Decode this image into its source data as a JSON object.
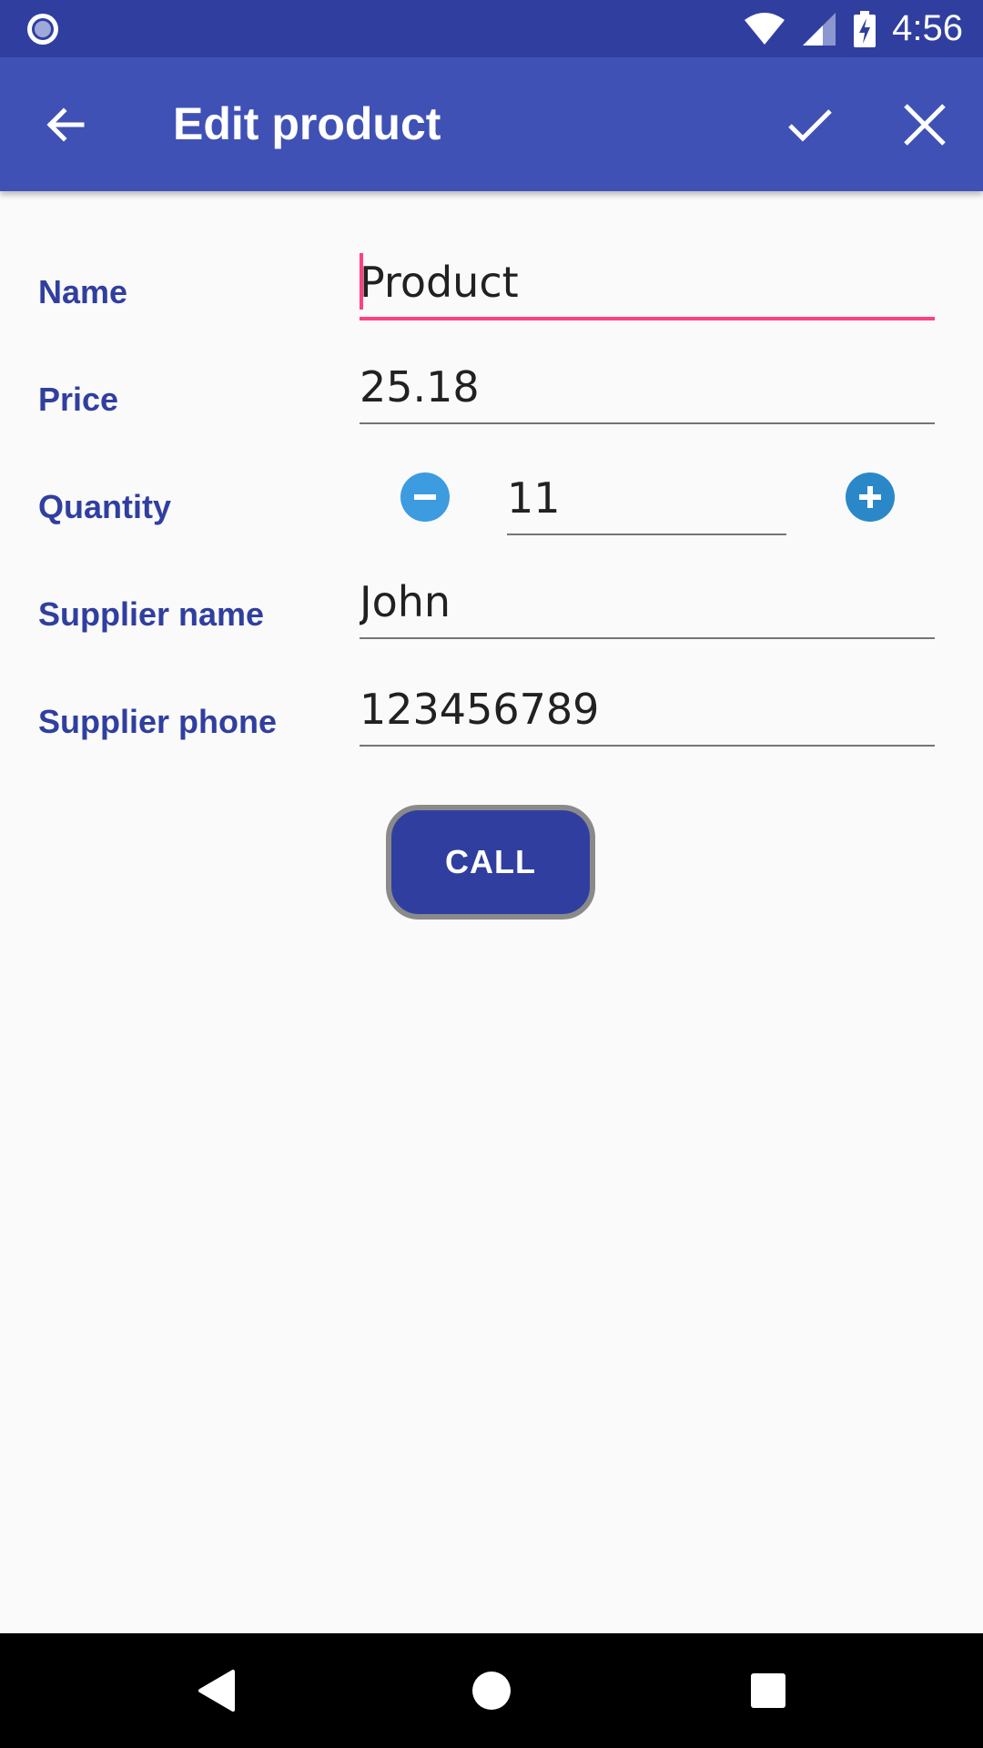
{
  "status_bar": {
    "time": "4:56",
    "icons": [
      "notification-dot-icon",
      "wifi-icon",
      "signal-icon",
      "battery-charging-icon"
    ]
  },
  "app_bar": {
    "title": "Edit product",
    "icons": [
      "arrow-back-icon",
      "check-icon",
      "close-icon"
    ]
  },
  "form": {
    "name": {
      "label": "Name",
      "value": "Product"
    },
    "price": {
      "label": "Price",
      "value": "25.18"
    },
    "quantity": {
      "label": "Quantity",
      "value": "11"
    },
    "supplier_name": {
      "label": "Supplier name",
      "value": "John"
    },
    "supplier_phone": {
      "label": "Supplier phone",
      "value": "123456789"
    }
  },
  "call_button": {
    "label": "CALL"
  },
  "nav_bar": {
    "icons": [
      "nav-back-icon",
      "nav-home-icon",
      "nav-recents-icon"
    ]
  },
  "colors": {
    "primary": "#3f51b5",
    "primary_dark": "#303f9f",
    "accent": "#ff4081",
    "background": "#fafafa"
  }
}
